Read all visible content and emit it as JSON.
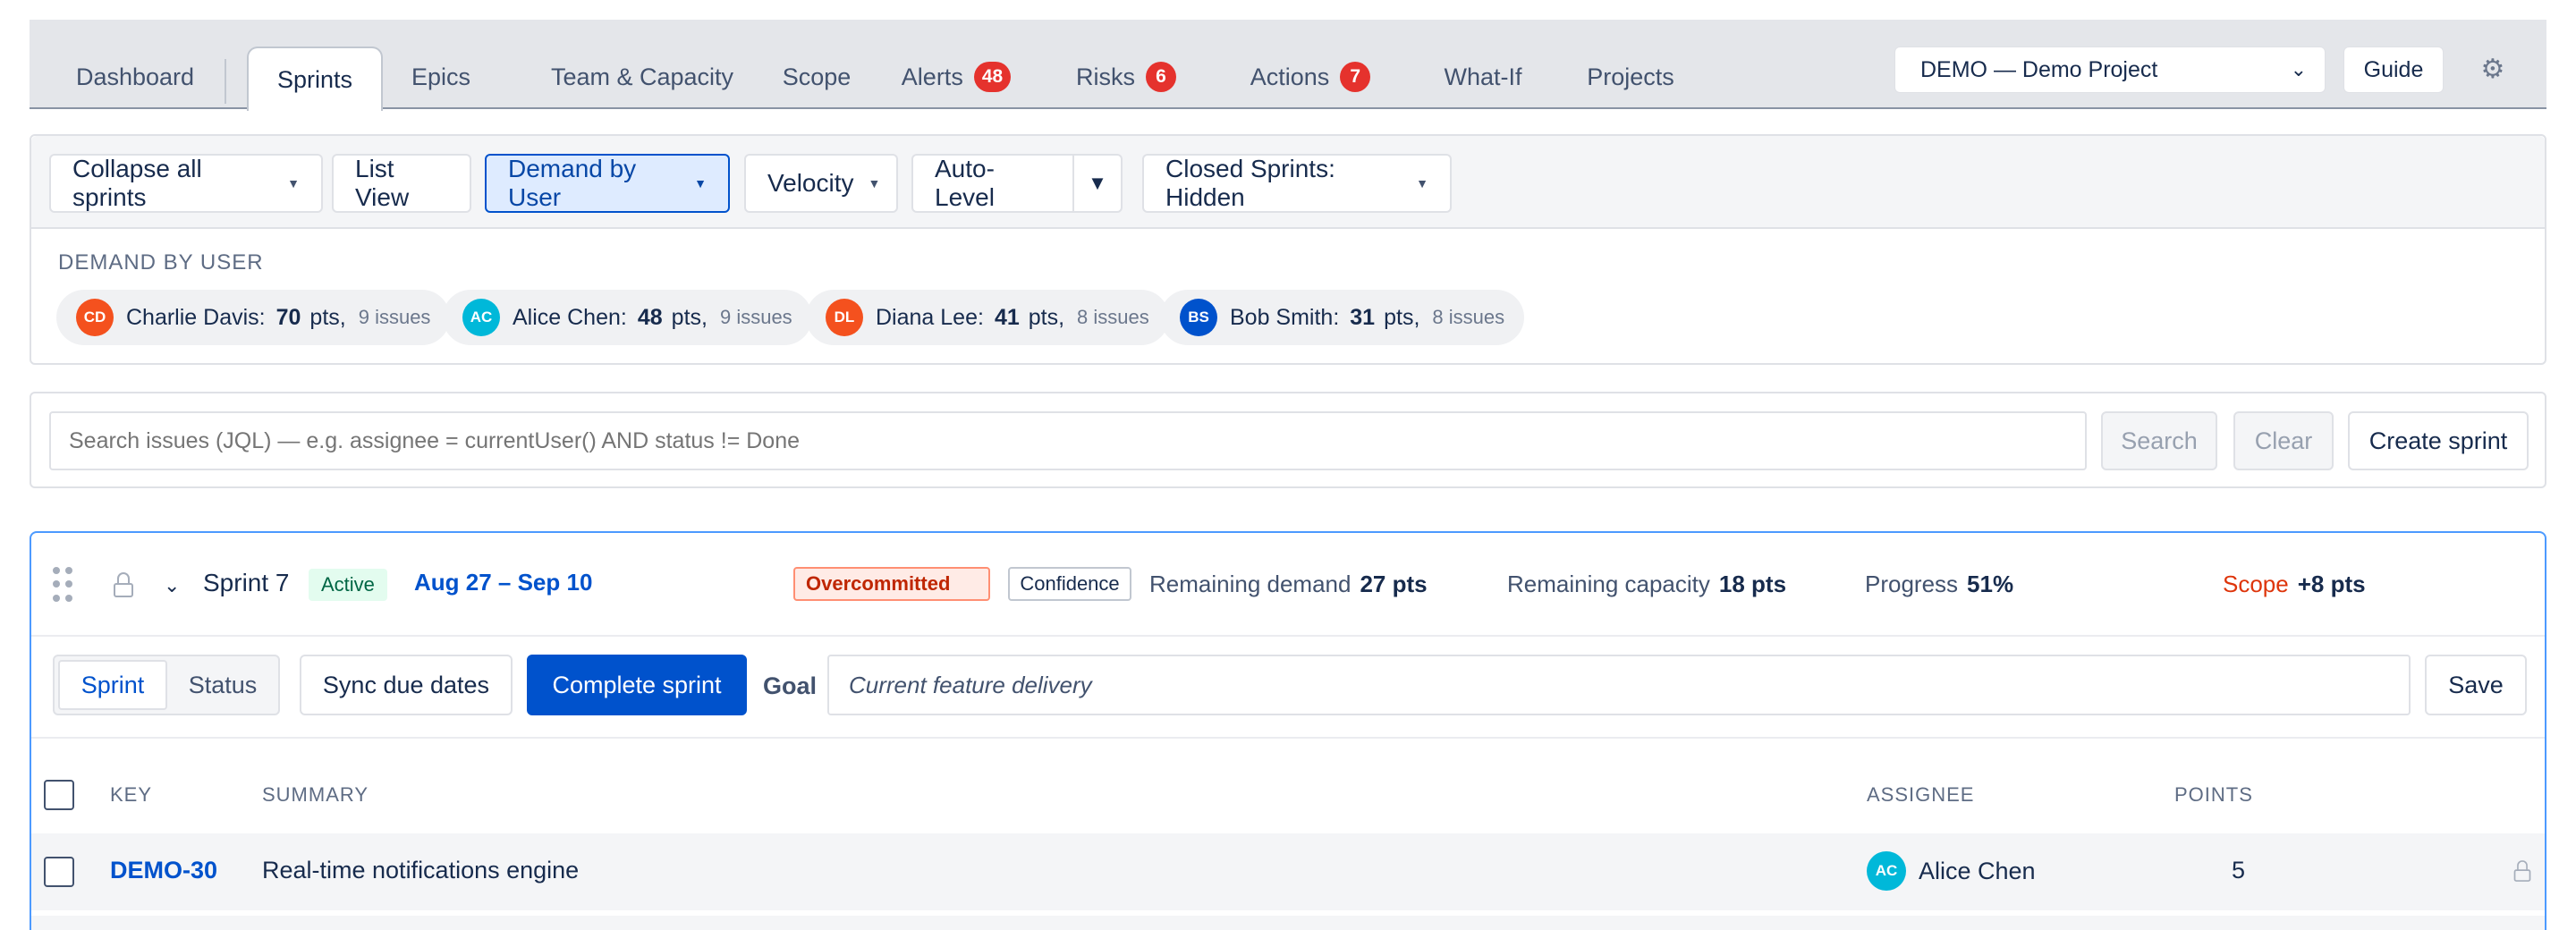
{
  "tabs": [
    {
      "label": "Dashboard"
    },
    {
      "label": "Sprints",
      "active": true
    },
    {
      "label": "Epics"
    },
    {
      "label": "Team & Capacity"
    },
    {
      "label": "Scope"
    },
    {
      "label": "Alerts",
      "badge": "48"
    },
    {
      "label": "Risks",
      "badge": "6"
    },
    {
      "label": "Actions",
      "badge": "7"
    },
    {
      "label": "What-If"
    },
    {
      "label": "Projects"
    }
  ],
  "project_select": {
    "value": "DEMO — Demo Project"
  },
  "header": {
    "guide_label": "Guide",
    "settings_icon": "gear-icon"
  },
  "toolbar": {
    "collapse_label": "Collapse all sprints",
    "list_view_label": "List View",
    "demand_label": "Demand by User",
    "velocity_label": "Velocity",
    "autolevel_label": "Auto-Level",
    "autolevel_caret": "▼",
    "closed_label": "Closed Sprints: Hidden"
  },
  "demand": {
    "title": "DEMAND BY USER",
    "users": [
      {
        "initials": "CD",
        "name": "Charlie Davis:",
        "pts": "70",
        "pts_unit": "pts,",
        "issues": "9 issues",
        "color": "#f4511e"
      },
      {
        "initials": "AC",
        "name": "Alice Chen:",
        "pts": "48",
        "pts_unit": "pts,",
        "issues": "9 issues",
        "color": "#00b8d9"
      },
      {
        "initials": "DL",
        "name": "Diana Lee:",
        "pts": "41",
        "pts_unit": "pts,",
        "issues": "8 issues",
        "color": "#f4511e"
      },
      {
        "initials": "BS",
        "name": "Bob Smith:",
        "pts": "31",
        "pts_unit": "pts,",
        "issues": "8 issues",
        "color": "#0052cc"
      }
    ]
  },
  "search": {
    "placeholder": "Search issues (JQL) — e.g. assignee = currentUser() AND status != Done",
    "search_label": "Search",
    "clear_label": "Clear",
    "create_label": "Create sprint"
  },
  "sprint": {
    "name": "Sprint 7",
    "status": "Active",
    "dates": "Aug 27 – Sep 10",
    "overcommitted": "Overcommitted",
    "confidence": "Confidence",
    "remaining_demand_label": "Remaining demand",
    "remaining_demand_value": "27 pts",
    "remaining_capacity_label": "Remaining capacity",
    "remaining_capacity_value": "18 pts",
    "progress_label": "Progress",
    "progress_value": "51%",
    "scope_label": "Scope",
    "scope_value": "+8 pts",
    "view_sprint": "Sprint",
    "view_status": "Status",
    "sync_label": "Sync due dates",
    "complete_label": "Complete sprint",
    "goal_label": "Goal",
    "goal_value": "Current feature delivery",
    "save_label": "Save"
  },
  "table": {
    "headers": {
      "key": "KEY",
      "summary": "SUMMARY",
      "assignee": "ASSIGNEE",
      "points": "POINTS"
    },
    "rows": [
      {
        "key": "DEMO-30",
        "summary": "Real-time notifications engine",
        "assignee_initials": "AC",
        "assignee": "Alice Chen",
        "assignee_color": "#00b8d9",
        "points": "5"
      }
    ]
  }
}
